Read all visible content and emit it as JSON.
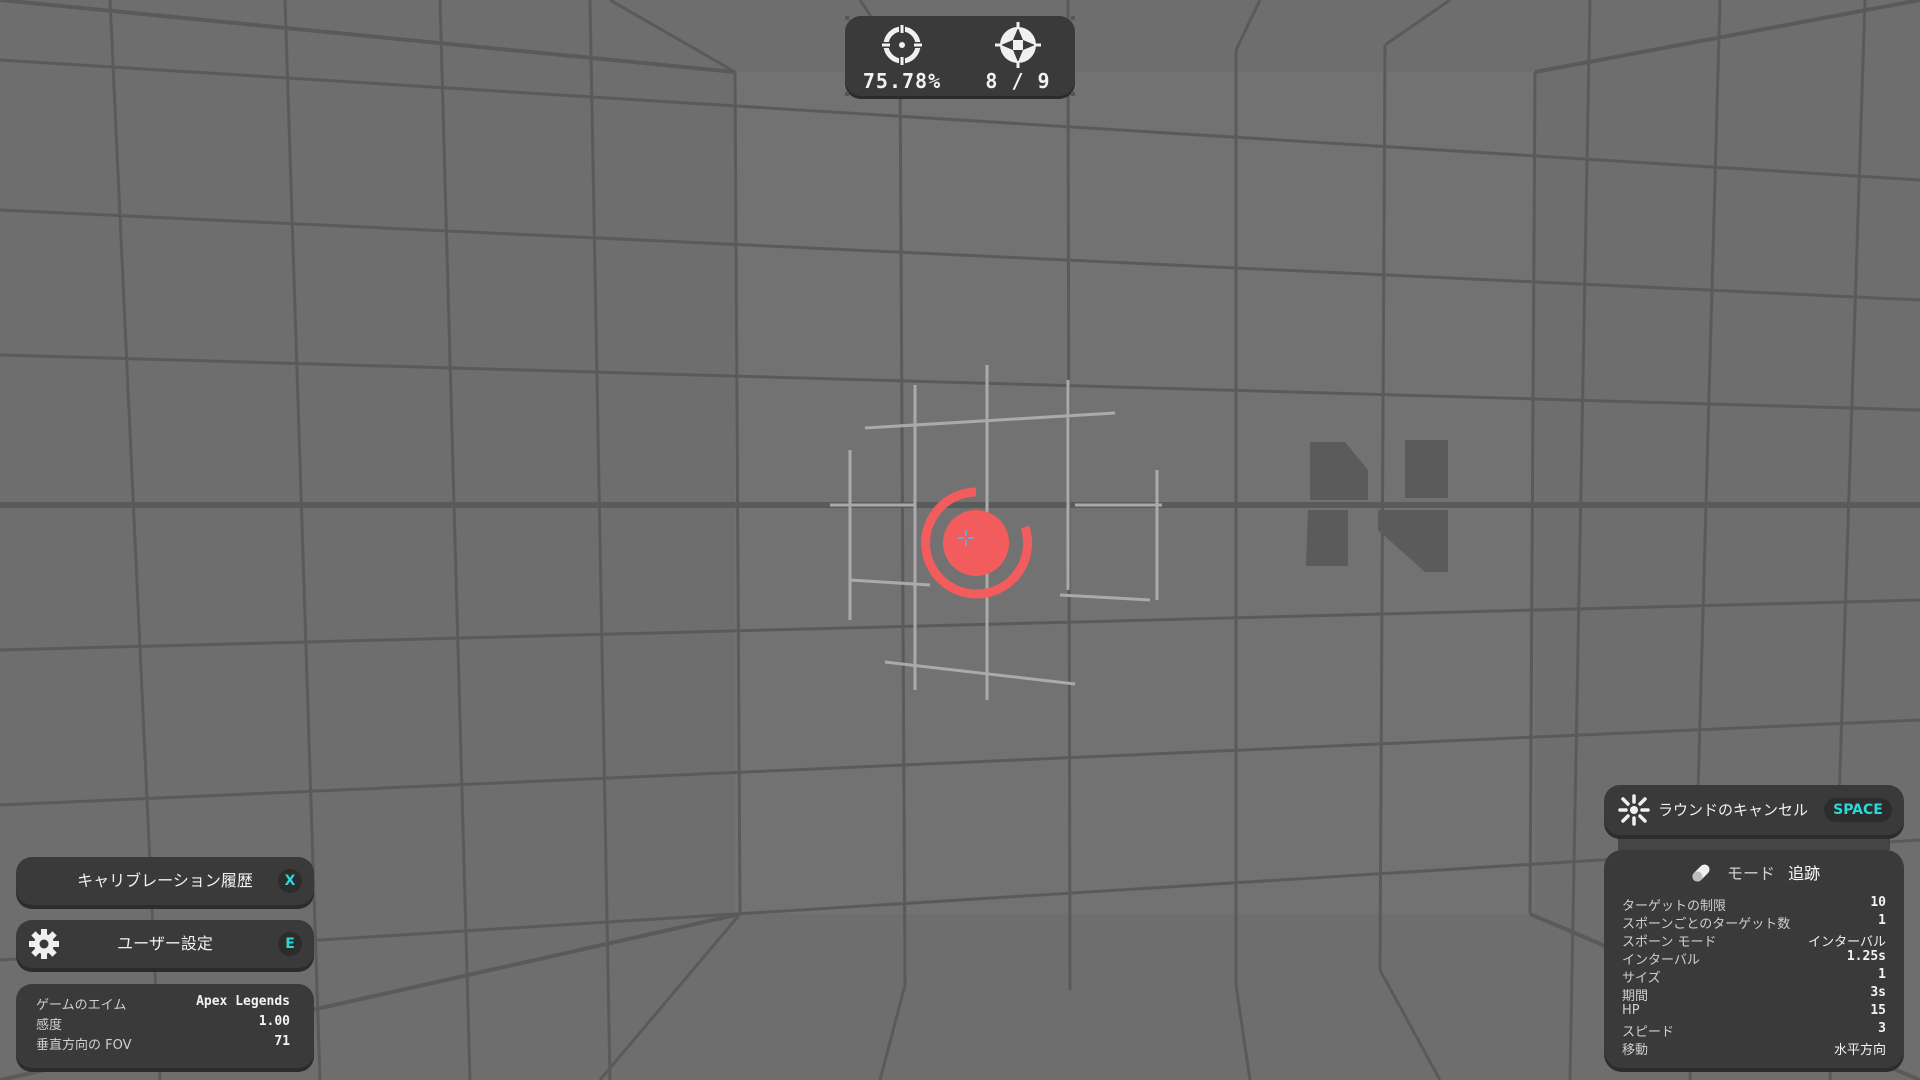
{
  "hud": {
    "accuracy": "75.78%",
    "hits": "8 / 9",
    "accuracy_icon": "crosshair-target-icon",
    "hits_icon": "target-reticle-icon"
  },
  "left_panel": {
    "calibration_label": "キャリブレーション履歴",
    "calibration_key": "X",
    "settings_label": "ユーザー設定",
    "settings_key": "E",
    "settings_icon": "gear-icon",
    "info": [
      {
        "key": "ゲームのエイム",
        "value": "Apex Legends"
      },
      {
        "key": "感度",
        "value": "1.00"
      },
      {
        "key": "垂直方向の FOV",
        "value": "71"
      }
    ]
  },
  "right_panel": {
    "cancel_label": "ラウンドのキャンセル",
    "cancel_key": "SPACE",
    "cancel_icon": "burst-icon",
    "mode_label": "モード",
    "mode_value": "追跡",
    "mode_icon": "pill-icon",
    "rows": [
      {
        "key": "ターゲットの制限",
        "value": "10"
      },
      {
        "key": "スポーンごとのターゲット数",
        "value": "1"
      },
      {
        "key": "スポーン モード",
        "value": "インターバル"
      },
      {
        "key": "インターバル",
        "value": "1.25s"
      },
      {
        "key": "サイズ",
        "value": "1"
      },
      {
        "key": "期間",
        "value": "3s"
      },
      {
        "key": "HP",
        "value": "15"
      },
      {
        "key": "スピード",
        "value": "3"
      },
      {
        "key": "移動",
        "value": "水平方向"
      }
    ]
  },
  "colors": {
    "background": "#6e6e6e",
    "grid": "#5a5a5a",
    "target": "#f25c5c",
    "key_accent": "#2fd6d6",
    "panel": "#3a3a3a"
  }
}
